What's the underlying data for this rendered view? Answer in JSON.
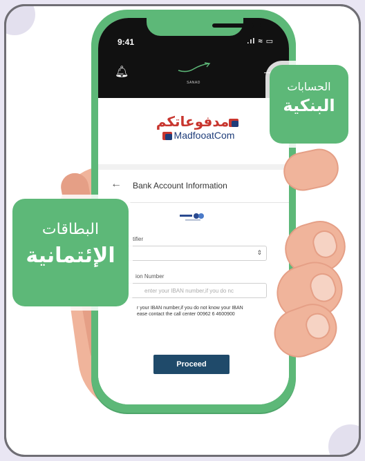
{
  "status_bar": {
    "time": "9:41",
    "icons": ".ıl ≈ ▭"
  },
  "app_header": {
    "brand_sub": "SANAD"
  },
  "madfooat": {
    "arabic": "مدفوعاتكم",
    "english": "MadfooatCom"
  },
  "bank_info": {
    "title": "Bank Account Information",
    "identifier_label": "tifier",
    "iban_label": "ion Number",
    "iban_placeholder": "enter your IBAN number,if you do nc",
    "help_line1": "r your IBAN number,if you do not know your IBAN",
    "help_line2": "ease contact the call center 00962 6 4600900",
    "proceed_label": "Proceed"
  },
  "badges": {
    "bank": {
      "line1": "الحسابات",
      "line2": "البنكية"
    },
    "cards": {
      "line1": "البطاقات",
      "line2": "الإئتمانية"
    }
  },
  "colors": {
    "accent_green": "#5db878",
    "proceed_button": "#1f4a6a",
    "brand_red": "#c8362f",
    "brand_blue": "#1f3d7a"
  }
}
